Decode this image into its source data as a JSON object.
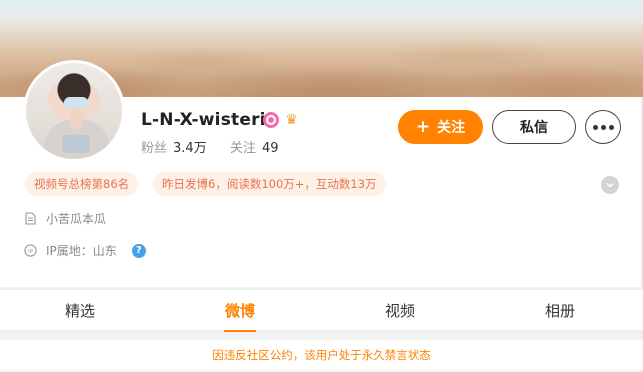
{
  "profile": {
    "username": "L-N-X-wisteria",
    "badges": [
      "vip-badge-icon",
      "crown-badge-icon"
    ],
    "stats": {
      "followers_label": "粉丝",
      "followers_value": "3.4万",
      "following_label": "关注",
      "following_value": "49"
    }
  },
  "actions": {
    "follow_plus": "+",
    "follow_label": "关注",
    "message_label": "私信",
    "more_icon": "ellipsis-icon"
  },
  "tags": [
    "视频号总榜第86名",
    "昨日发博6，阅读数100万+，互动数13万"
  ],
  "info": {
    "bio": "小苦瓜本瓜",
    "ip_location": "IP属地：山东",
    "help_icon_text": "?"
  },
  "tabs": [
    {
      "label": "精选",
      "active": false
    },
    {
      "label": "微博",
      "active": true
    },
    {
      "label": "视频",
      "active": false
    },
    {
      "label": "相册",
      "active": false
    }
  ],
  "notice": "因违反社区公约，该用户处于永久禁言状态",
  "colors": {
    "accent": "#ff8200",
    "tag_text": "#eb7350",
    "tag_bg": "#fdf0e6",
    "help_icon": "#4aa0e6"
  }
}
